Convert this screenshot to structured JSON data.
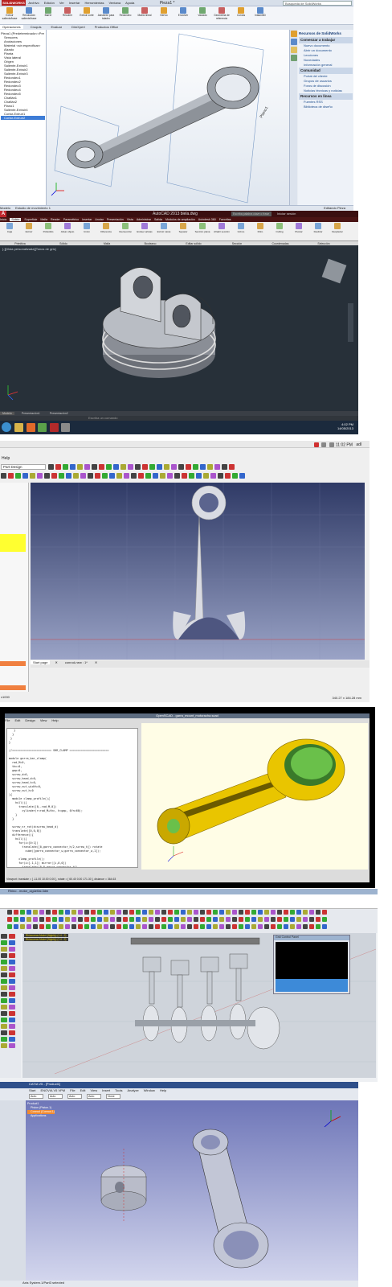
{
  "solidworks": {
    "app_name": "SOLIDWORKS",
    "menu": [
      "Archivo",
      "Edición",
      "Ver",
      "Insertar",
      "Herramientas",
      "Ventana",
      "Ayuda"
    ],
    "doc_title": "Pieza1 *",
    "search_placeholder": "Búsqueda de SolidWorks",
    "ribbon": [
      "Extruir saliente/base",
      "Revolución saliente/base",
      "Barrer",
      "Recubrir",
      "Extruir corte",
      "Asistente para taladro",
      "Redondeo",
      "Matriz lineal",
      "Nervio",
      "Envolver",
      "Vaciado",
      "Geometría de referencia",
      "Curvas",
      "Instant3D"
    ],
    "cm_tabs": [
      "Operaciones",
      "Croquis",
      "Evaluar",
      "DimXpert",
      "Productos Office"
    ],
    "tree": [
      "Pieza1 (Predeterminado<<Pre",
      "Sensores",
      "Anotaciones",
      "Material <sin especificar>",
      "Alzado",
      "Planta",
      "Vista lateral",
      "Origen",
      "Saliente-Extruir1",
      "Saliente-Extruir2",
      "Saliente-Extruir3",
      "Redondeo1",
      "Redondeo2",
      "Redondeo3",
      "Redondeo4",
      "Redondeo5",
      "Chaflán1",
      "Chaflán2",
      "Plano1",
      "Saliente-Extruir4",
      "Cortar-Extruir1",
      "Cortar-Extruir2"
    ],
    "bottom_tabs": [
      "Modelo",
      "Estudio de movimiento 1"
    ],
    "status": "Editando Pieza",
    "resources_title": "Recursos de SolidWorks",
    "resources_sections": [
      {
        "title": "Comenzar a trabajar",
        "items": [
          "Nuevo documento",
          "Abrir un documento",
          "Lecciones",
          "Novedades",
          "Información general"
        ]
      },
      {
        "title": "Comunidad",
        "items": [
          "Portal del cliente",
          "Grupos de usuarios",
          "Foros de discusión",
          "Noticias técnicas y noticias"
        ]
      },
      {
        "title": "Recursos en línea",
        "items": [
          "Fuentes RSS",
          "Biblioteca de diseño"
        ]
      }
    ]
  },
  "autocad": {
    "title": "AutoCAD 2013   biela.dwg",
    "search_placeholder": "Escriba palabra clave o frase",
    "user": "Iniciar sesión",
    "tabs": [
      "Inicio",
      "Sólido",
      "Superficie",
      "Malla",
      "Render",
      "Paramétrico",
      "Insertar",
      "Anotar",
      "Presentación",
      "Vista",
      "Administrar",
      "Salida",
      "Módulos de ampliación",
      "Autodesk 360",
      "Favoritas"
    ],
    "ribbon": [
      "Caja",
      "Extruir",
      "Polisólido",
      "Alisar objeto",
      "Unión",
      "Diferencia",
      "Intersección",
      "Extraer aristas",
      "Extruir caras",
      "Separar",
      "Sección plana",
      "Añadir sección",
      "Gizmo",
      "Filtro",
      "Culling",
      "Pivotar",
      "Deslizar",
      "Desplazar"
    ],
    "panels": [
      "Primitiva",
      "Sólido",
      "Malla",
      "Booleano",
      "Editar sólido",
      "Sección",
      "Coordenadas",
      "Selección"
    ],
    "viewport_label": "[-][Vista personalizada][Tonos de gris]",
    "layout_tabs": [
      "Modelo",
      "Presentación1",
      "Presentación2"
    ],
    "command_prompt": "Escriba un comando",
    "time": "4:02 PM",
    "date": "14/05/2013"
  },
  "freecad": {
    "time": "11:02 PM",
    "user": "adl",
    "menu_item": "Help",
    "workbench": "Part Design",
    "doc_tabs": [
      "Start page",
      "conrod-new : 1*"
    ],
    "coords": "340.27 x 184.28 mm",
    "status_left": "x1000"
  },
  "openscad": {
    "title": "OpenSCAD - garra_mount_motoracha.scad",
    "menu": [
      "File",
      "Edit",
      "Design",
      "View",
      "Help"
    ],
    "code": [
      "   }",
      "  }",
      " }",
      "}",
      "",
      "//======================== SHR_CLAMP ========================",
      "",
      "module garra_bar_clamp(",
      "  rad_M=0,",
      "  thc=0,",
      "  gap=0,",
      "  screw_d=0,",
      "  screw_head_d=0,",
      "  screw_head_h=0,",
      "  screw_nut_width=0,",
      "  screw_nut_h=0",
      "){",
      "  module clamp_profile(){",
      "    hull(){",
      "      translate([0,-rad_M,0])",
      "        cylinder(r=rad_M+thc, h=gap, $fn=60);",
      "    }",
      "  }",
      "",
      "  screw_nr_rot(d=screw_head_d)",
      "  translate([0,0,0])",
      "  difference(){",
      "    hull(){",
      "      for(i=[0:1])",
      "        translate([0,garra_connector_h/2,screw_h]) rotate",
      "          cube([garra_connector_w,garra_connector_w,1]);",
      "",
      "      clamp_profile();",
      "      for(i=[-1,1]) mirror([i,0,0])",
      "        translate([0,0,garra_connector_h])",
      "          clamp_profile(rad=0.0);",
      "",
      "    // Shaft clamp",
      "    for(i=[-1,1]) rotate([0,0,i*90])"
    ],
    "status": "Viewport: translate = [ -11.00 10.00 0.00 ], rotate = [ 60.40 0.00 171.30 ], distance = 364.63"
  },
  "rhino": {
    "title": "Rhino - motor_cigüeñal.3dm",
    "command_lines": [
      "Rhinoceros Model (Nightly) (1.4 - 2)",
      "Rhinoceros Model (Nightly) (1.4 - 2)"
    ],
    "popup_title": "Grid Control Panel"
  },
  "catia": {
    "title": "CATIA V5 - [Product1]",
    "menu": [
      "Start",
      "ENOVIA V5 VPM",
      "File",
      "Edit",
      "View",
      "Insert",
      "Tools",
      "Analyze",
      "Window",
      "Help"
    ],
    "toolbar_selects": [
      "Auto",
      "Auto",
      "Auto",
      "Auto",
      "None"
    ],
    "tree": [
      "Product1",
      "Piston (Piston.1)",
      "Conrod (Conrod.1)",
      "Applications"
    ],
    "status": "Axis System.1/Part3 selected"
  }
}
